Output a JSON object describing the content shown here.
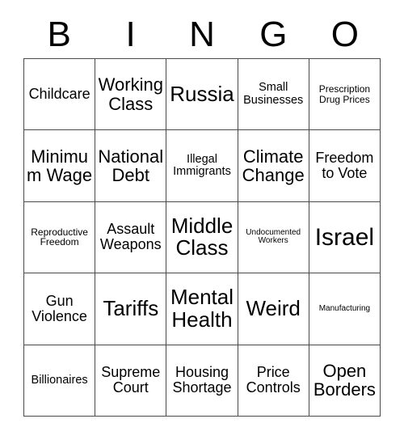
{
  "card": {
    "title": "BINGO",
    "header_letters": [
      "B",
      "I",
      "N",
      "G",
      "O"
    ],
    "grid_size": "5x5",
    "free_space": false,
    "colors": {
      "background": "#ffffff",
      "text": "#000000",
      "grid_line": "#4a4a4a"
    },
    "rows": [
      [
        {
          "label": "Childcare",
          "size": "md"
        },
        {
          "label": "Working Class",
          "size": "lg"
        },
        {
          "label": "Russia",
          "size": "xl"
        },
        {
          "label": "Small Businesses",
          "size": "sm"
        },
        {
          "label": "Prescription Drug Prices",
          "size": "xs"
        }
      ],
      [
        {
          "label": "Minimum Wage",
          "size": "lg"
        },
        {
          "label": "National Debt",
          "size": "lg"
        },
        {
          "label": "Illegal Immigrants",
          "size": "sm"
        },
        {
          "label": "Climate Change",
          "size": "lg"
        },
        {
          "label": "Freedom to Vote",
          "size": "md"
        }
      ],
      [
        {
          "label": "Reproductive Freedom",
          "size": "xs"
        },
        {
          "label": "Assault Weapons",
          "size": "md"
        },
        {
          "label": "Middle Class",
          "size": "xl"
        },
        {
          "label": "Undocumented Workers",
          "size": "xxs"
        },
        {
          "label": "Israel",
          "size": "xxl"
        }
      ],
      [
        {
          "label": "Gun Violence",
          "size": "md"
        },
        {
          "label": "Tariffs",
          "size": "xl"
        },
        {
          "label": "Mental Health",
          "size": "xl"
        },
        {
          "label": "Weird",
          "size": "xl"
        },
        {
          "label": "Manufacturing",
          "size": "xxs"
        }
      ],
      [
        {
          "label": "Billionaires",
          "size": "sm"
        },
        {
          "label": "Supreme Court",
          "size": "md"
        },
        {
          "label": "Housing Shortage",
          "size": "md"
        },
        {
          "label": "Price Controls",
          "size": "md"
        },
        {
          "label": "Open Borders",
          "size": "lg"
        }
      ]
    ]
  }
}
